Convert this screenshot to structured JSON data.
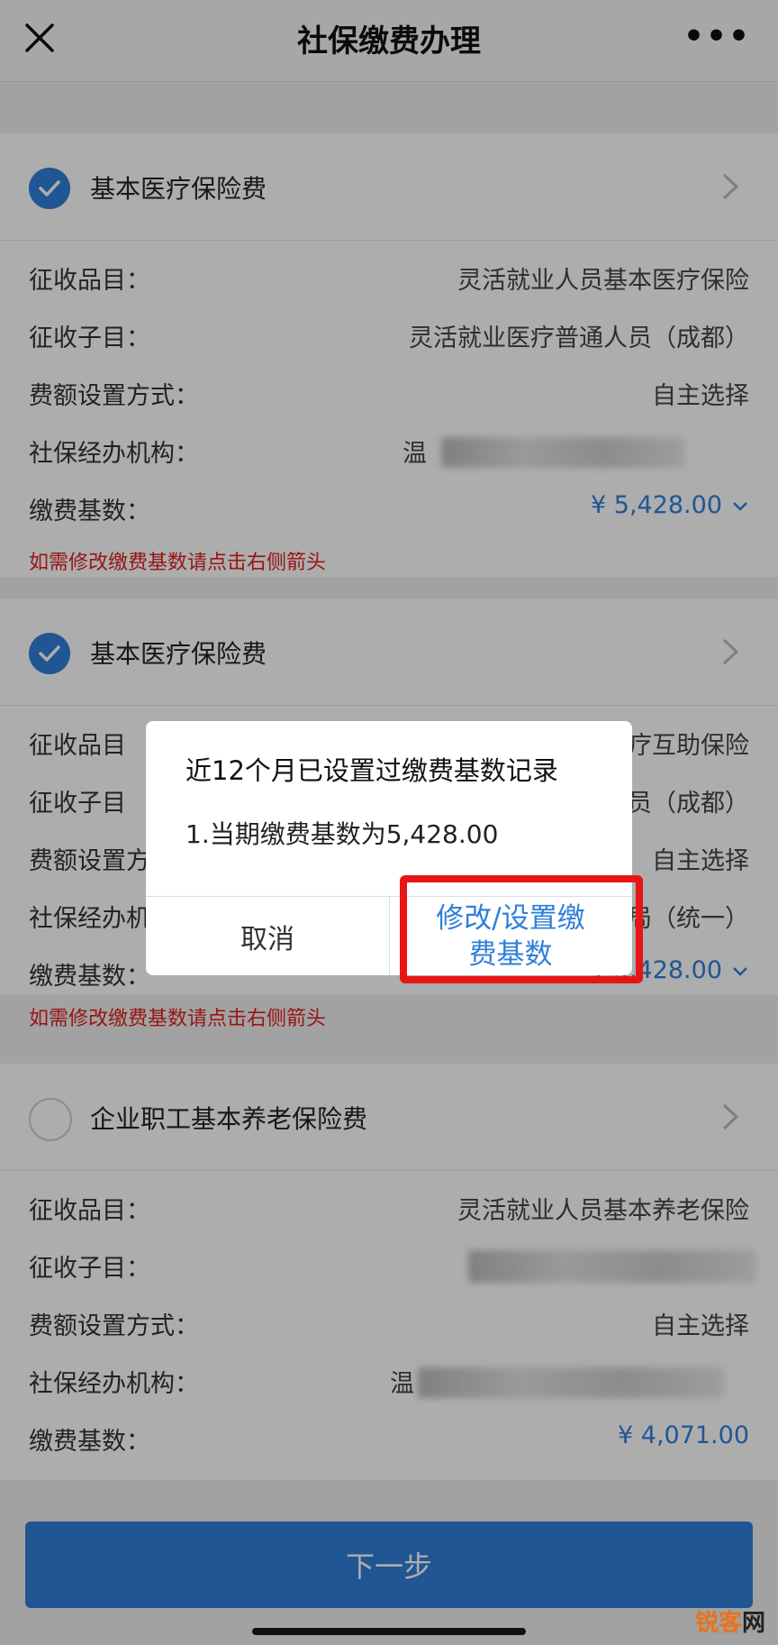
{
  "nav": {
    "title": "社保缴费办理"
  },
  "sections": [
    {
      "title": "基本医疗保险费",
      "checked": true,
      "rows": [
        {
          "label": "征收品目：",
          "value": "灵活就业人员基本医疗保险"
        },
        {
          "label": "征收子目：",
          "value": "灵活就业医疗普通人员（成都）"
        },
        {
          "label": "费额设置方式：",
          "value": "自主选择"
        },
        {
          "label": "社保经办机构：",
          "value": "温"
        },
        {
          "label": "缴费基数：",
          "value": "¥ 5,428.00"
        }
      ],
      "hint": "如需修改缴费基数请点击右侧箭头"
    },
    {
      "title": "基本医疗保险费",
      "checked": true,
      "rows": [
        {
          "label": "征收品目",
          "value": "疗互助保险"
        },
        {
          "label": "征收子目",
          "value": "员（成都）"
        },
        {
          "label": "费额设置方",
          "value": "自主选择"
        },
        {
          "label": "社保经办机",
          "value": "局（统一）"
        },
        {
          "label": "缴费基数：",
          "value": "¥ 5,428.00"
        }
      ],
      "hint": "如需修改缴费基数请点击右侧箭头"
    },
    {
      "title": "企业职工基本养老保险费",
      "checked": false,
      "rows": [
        {
          "label": "征收品目：",
          "value": "灵活就业人员基本养老保险"
        },
        {
          "label": "征收子目：",
          "value": ""
        },
        {
          "label": "费额设置方式：",
          "value": "自主选择"
        },
        {
          "label": "社保经办机构：",
          "value": "温"
        },
        {
          "label": "缴费基数：",
          "value": "¥ 4,071.00"
        }
      ]
    }
  ],
  "dialog": {
    "title": "近12个月已设置过缴费基数记录",
    "message": "1.当期缴费基数为5,428.00",
    "cancel": "取消",
    "confirm": "修改/设置缴\n费基数"
  },
  "next_button": "下一步",
  "watermark": "锐客网",
  "colors": {
    "accent": "#2f7fd9",
    "hint": "#e02020",
    "highlight": "#e81515"
  }
}
